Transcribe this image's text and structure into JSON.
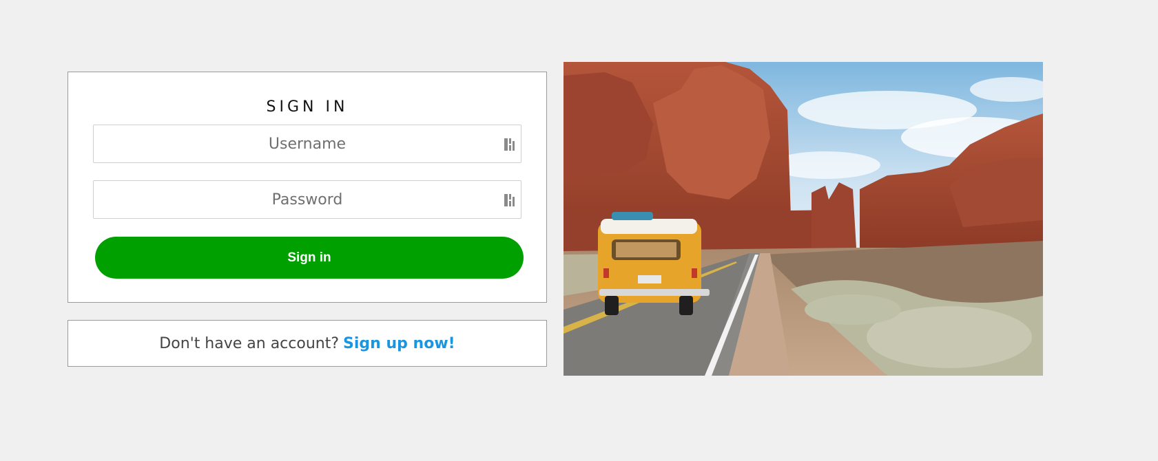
{
  "signin": {
    "title": "SIGN IN",
    "username_placeholder": "Username",
    "password_placeholder": "Password",
    "submit_label": "Sign in"
  },
  "signup": {
    "prompt": "Don't have an account?",
    "link_label": "Sign up now!"
  },
  "icons": {
    "field_icon": "password-manager-key-icon"
  },
  "colors": {
    "background": "#f0f0f0",
    "button": "#00a000",
    "link": "#1a96e0"
  },
  "hero": {
    "subject": "yellow-van-desert-road-photo"
  }
}
